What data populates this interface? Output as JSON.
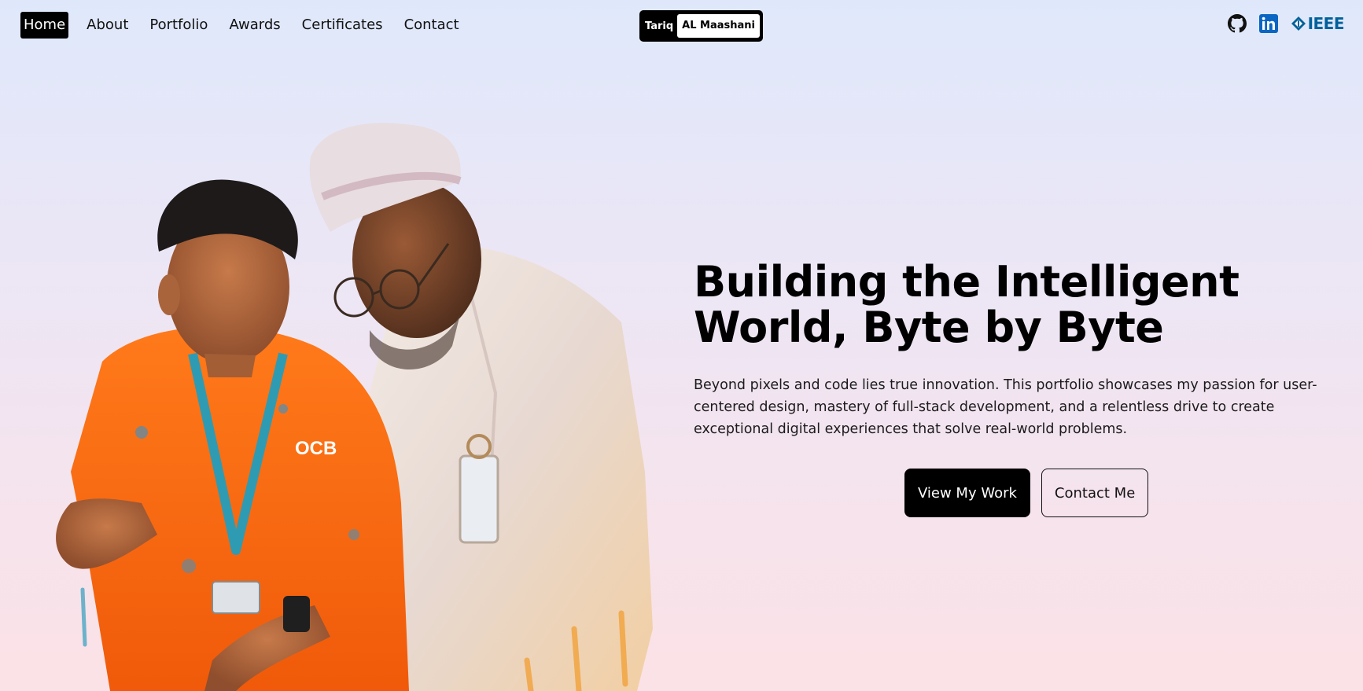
{
  "nav": {
    "items": [
      {
        "label": "Home",
        "active": true
      },
      {
        "label": "About"
      },
      {
        "label": "Portfolio"
      },
      {
        "label": "Awards"
      },
      {
        "label": "Certificates"
      },
      {
        "label": "Contact"
      }
    ]
  },
  "logo": {
    "first": "Tariq",
    "last": "AL Maashani"
  },
  "social": {
    "github_icon": "github-icon",
    "linkedin_icon": "linkedin-icon",
    "ieee_label": "IEEE"
  },
  "hero": {
    "image_text": "OCB",
    "headline_line1": "Building the Intelligent",
    "headline_line2": "World, Byte by Byte",
    "subtext": "Beyond pixels and code lies true innovation. This portfolio showcases my passion for user-centered design, mastery of full-stack development, and a relentless drive to create exceptional digital experiences that solve real-world problems.",
    "primary_button": "View My Work",
    "secondary_button": "Contact Me"
  },
  "colors": {
    "accent": "#000000",
    "ieee_blue": "#00629b",
    "linkedin_blue": "#0a66c2"
  }
}
